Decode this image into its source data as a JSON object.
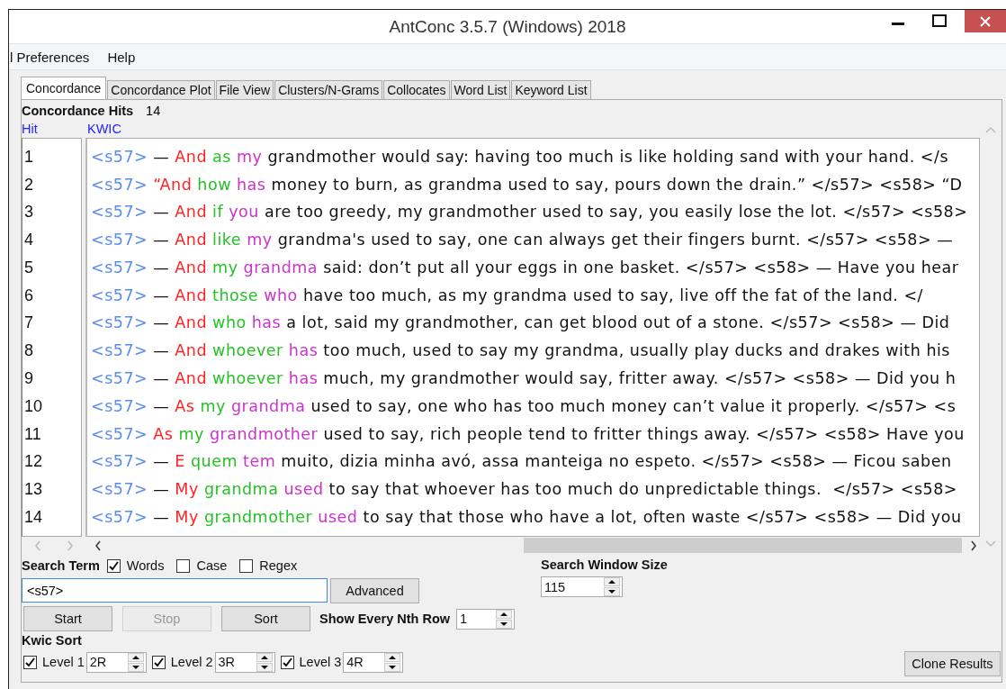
{
  "window": {
    "title": "AntConc 3.5.7 (Windows) 2018"
  },
  "menu": [
    {
      "label": "l Preferences"
    },
    {
      "label": "Help"
    }
  ],
  "tabs": [
    {
      "label": "Concordance",
      "selected": true
    },
    {
      "label": "Concordance Plot",
      "selected": false
    },
    {
      "label": "File View",
      "selected": false
    },
    {
      "label": "Clusters/N-Grams",
      "selected": false
    },
    {
      "label": "Collocates",
      "selected": false
    },
    {
      "label": "Word List",
      "selected": false
    },
    {
      "label": "Keyword List",
      "selected": false
    }
  ],
  "hits": {
    "label": "Concordance Hits",
    "count": "14"
  },
  "columns": [
    "Hit",
    "KWIC"
  ],
  "rows": [
    {
      "hit": "1",
      "segments": [
        {
          "kind": "tag",
          "text": "<s57>"
        },
        {
          "kind": "plain",
          "text": " — "
        },
        {
          "kind": "hit",
          "text": "And "
        },
        {
          "kind": "r1",
          "text": "as "
        },
        {
          "kind": "r2",
          "text": "my"
        },
        {
          "kind": "plain",
          "text": " grandmother would say: having too much is like holding sand with your hand. </s"
        }
      ]
    },
    {
      "hit": "2",
      "segments": [
        {
          "kind": "tag",
          "text": "<s57>"
        },
        {
          "kind": "hit",
          "text": " “And "
        },
        {
          "kind": "r1",
          "text": "how "
        },
        {
          "kind": "r2",
          "text": "has"
        },
        {
          "kind": "plain",
          "text": " money to burn, as grandma used to say, pours down the drain.” </s57> <s58> “D"
        }
      ]
    },
    {
      "hit": "3",
      "segments": [
        {
          "kind": "tag",
          "text": "<s57>"
        },
        {
          "kind": "plain",
          "text": " — "
        },
        {
          "kind": "hit",
          "text": "And "
        },
        {
          "kind": "r1",
          "text": "if "
        },
        {
          "kind": "r2",
          "text": "you"
        },
        {
          "kind": "plain",
          "text": " are too greedy, my grandmother used to say, you easily lose the lot. </s57> <s58>"
        }
      ]
    },
    {
      "hit": "4",
      "segments": [
        {
          "kind": "tag",
          "text": "<s57>"
        },
        {
          "kind": "plain",
          "text": " — "
        },
        {
          "kind": "hit",
          "text": "And "
        },
        {
          "kind": "r1",
          "text": "like "
        },
        {
          "kind": "r2",
          "text": "my"
        },
        {
          "kind": "plain",
          "text": " grandma's used to say, one can always get their fingers burnt. </s57> <s58> —"
        }
      ]
    },
    {
      "hit": "5",
      "segments": [
        {
          "kind": "tag",
          "text": "<s57>"
        },
        {
          "kind": "plain",
          "text": " — "
        },
        {
          "kind": "hit",
          "text": "And "
        },
        {
          "kind": "r1",
          "text": "my "
        },
        {
          "kind": "r2",
          "text": "grandma"
        },
        {
          "kind": "plain",
          "text": " said: don’t put all your eggs in one basket. </s57> <s58> — Have you hear"
        }
      ]
    },
    {
      "hit": "6",
      "segments": [
        {
          "kind": "tag",
          "text": "<s57>"
        },
        {
          "kind": "plain",
          "text": " — "
        },
        {
          "kind": "hit",
          "text": "And "
        },
        {
          "kind": "r1",
          "text": "those "
        },
        {
          "kind": "r2",
          "text": "who"
        },
        {
          "kind": "plain",
          "text": " have too much, as my grandma used to say, live off the fat of the land. </"
        }
      ]
    },
    {
      "hit": "7",
      "segments": [
        {
          "kind": "tag",
          "text": "<s57>"
        },
        {
          "kind": "plain",
          "text": " — "
        },
        {
          "kind": "hit",
          "text": "And "
        },
        {
          "kind": "r1",
          "text": "who "
        },
        {
          "kind": "r2",
          "text": "has"
        },
        {
          "kind": "plain",
          "text": " a lot, said my grandmother, can get blood out of a stone. </s57> <s58> — Did"
        }
      ]
    },
    {
      "hit": "8",
      "segments": [
        {
          "kind": "tag",
          "text": "<s57>"
        },
        {
          "kind": "plain",
          "text": " — "
        },
        {
          "kind": "hit",
          "text": "And "
        },
        {
          "kind": "r1",
          "text": "whoever "
        },
        {
          "kind": "r2",
          "text": "has"
        },
        {
          "kind": "plain",
          "text": " too much, used to say my grandma, usually play ducks and drakes with his"
        }
      ]
    },
    {
      "hit": "9",
      "segments": [
        {
          "kind": "tag",
          "text": "<s57>"
        },
        {
          "kind": "plain",
          "text": " — "
        },
        {
          "kind": "hit",
          "text": "And "
        },
        {
          "kind": "r1",
          "text": "whoever "
        },
        {
          "kind": "r2",
          "text": "has"
        },
        {
          "kind": "plain",
          "text": " much, my grandmother would say, fritter away. </s57> <s58> — Did you h"
        }
      ]
    },
    {
      "hit": "10",
      "segments": [
        {
          "kind": "tag",
          "text": "<s57>"
        },
        {
          "kind": "plain",
          "text": " — "
        },
        {
          "kind": "hit",
          "text": "As "
        },
        {
          "kind": "r1",
          "text": "my "
        },
        {
          "kind": "r2",
          "text": "grandma"
        },
        {
          "kind": "plain",
          "text": " used to say, one who has too much money can’t value it properly. </s57> <s"
        }
      ]
    },
    {
      "hit": "11",
      "segments": [
        {
          "kind": "tag",
          "text": "<s57>"
        },
        {
          "kind": "hit",
          "text": " As "
        },
        {
          "kind": "r1",
          "text": "my "
        },
        {
          "kind": "r2",
          "text": "grandmother"
        },
        {
          "kind": "plain",
          "text": " used to say, rich people tend to fritter things away. </s57> <s58> Have you"
        }
      ]
    },
    {
      "hit": "12",
      "segments": [
        {
          "kind": "tag",
          "text": "<s57>"
        },
        {
          "kind": "plain",
          "text": " — "
        },
        {
          "kind": "hit",
          "text": "E "
        },
        {
          "kind": "r1",
          "text": "quem "
        },
        {
          "kind": "r2",
          "text": "tem"
        },
        {
          "kind": "plain",
          "text": " muito, dizia minha avó, assa manteiga no espeto. </s57> <s58> — Ficou saben"
        }
      ]
    },
    {
      "hit": "13",
      "segments": [
        {
          "kind": "tag",
          "text": "<s57>"
        },
        {
          "kind": "plain",
          "text": " — "
        },
        {
          "kind": "hit",
          "text": "My "
        },
        {
          "kind": "r1",
          "text": "grandma "
        },
        {
          "kind": "r2",
          "text": "used"
        },
        {
          "kind": "plain",
          "text": " to say that whoever has too much do unpredictable things.  </s57> <s58>"
        }
      ]
    },
    {
      "hit": "14",
      "segments": [
        {
          "kind": "tag",
          "text": "<s57>"
        },
        {
          "kind": "plain",
          "text": " — "
        },
        {
          "kind": "hit",
          "text": "My "
        },
        {
          "kind": "r1",
          "text": "grandmother "
        },
        {
          "kind": "r2",
          "text": "used"
        },
        {
          "kind": "plain",
          "text": " to say that those who have a lot, often waste </s57> <s58> — Did you"
        }
      ]
    }
  ],
  "search": {
    "label": "Search Term",
    "options": [
      {
        "label": "Words",
        "checked": true
      },
      {
        "label": "Case",
        "checked": false
      },
      {
        "label": "Regex",
        "checked": false
      }
    ],
    "value": "<s57>",
    "advanced": "Advanced"
  },
  "buttons": [
    {
      "label": "Start",
      "disabled": false
    },
    {
      "label": "Stop",
      "disabled": true
    },
    {
      "label": "Sort",
      "disabled": false
    }
  ],
  "nth_row": {
    "label": "Show Every Nth Row",
    "value": "1"
  },
  "window_size": {
    "label": "Search Window Size",
    "value": "115"
  },
  "kwic_sort": {
    "label": "Kwic Sort",
    "levels": [
      {
        "label": "Level 1",
        "checked": true,
        "value": "2R"
      },
      {
        "label": "Level 2",
        "checked": true,
        "value": "3R"
      },
      {
        "label": "Level 3",
        "checked": true,
        "value": "4R"
      }
    ]
  },
  "clone_button": "Clone Results"
}
